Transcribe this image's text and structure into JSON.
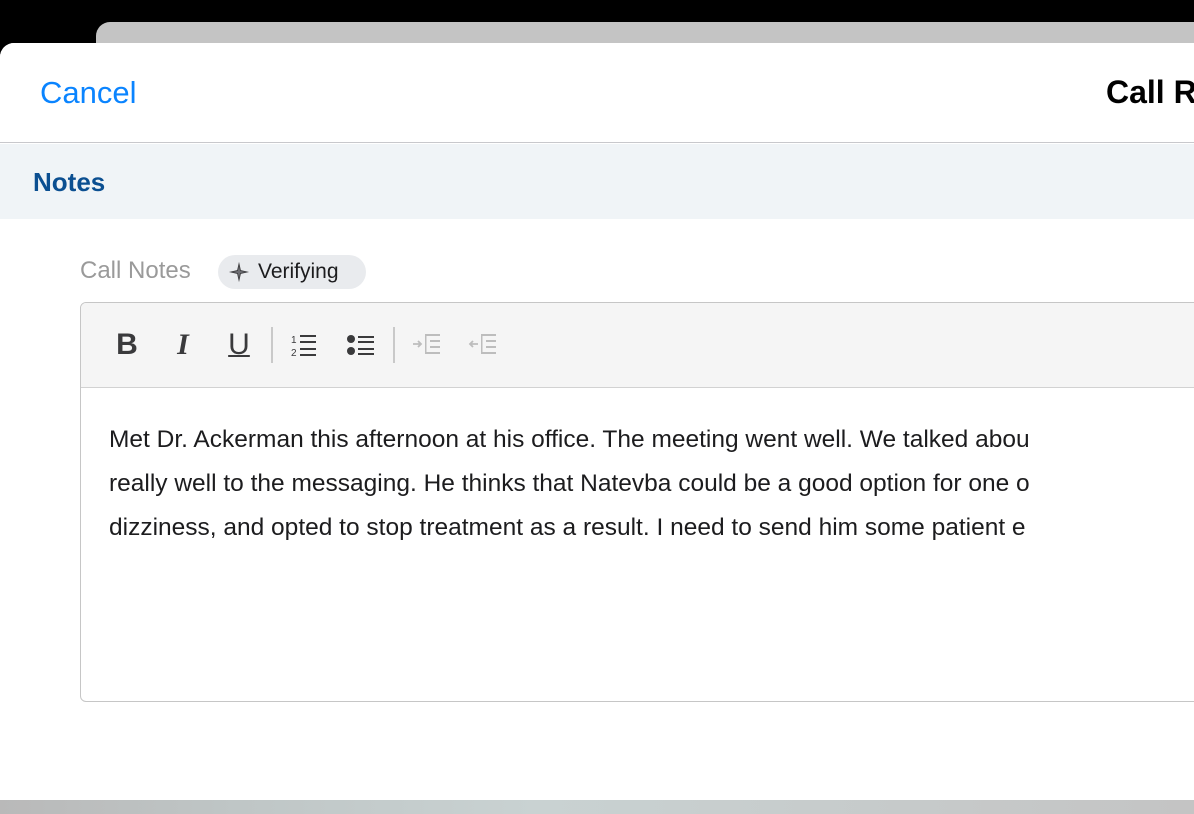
{
  "navbar": {
    "cancel_label": "Cancel",
    "title": "Call R"
  },
  "section": {
    "title": "Notes"
  },
  "field": {
    "label": "Call Notes",
    "badge_label": "Verifying",
    "badge_icon": "sparkle-icon"
  },
  "toolbar": {
    "buttons": [
      {
        "name": "bold",
        "glyph": "B",
        "icon": "bold-icon"
      },
      {
        "name": "italic",
        "glyph": "I",
        "icon": "italic-icon"
      },
      {
        "name": "underline",
        "glyph": "U",
        "icon": "underline-icon"
      },
      {
        "name": "ordered-list",
        "icon": "numbered-list-icon"
      },
      {
        "name": "bullet-list",
        "icon": "bulleted-list-icon"
      },
      {
        "name": "indent",
        "icon": "indent-icon",
        "disabled": true
      },
      {
        "name": "outdent",
        "icon": "outdent-icon",
        "disabled": true
      }
    ]
  },
  "editor": {
    "lines": [
      "Met Dr. Ackerman this afternoon at his office. The meeting went well. We talked abou",
      "really well to the messaging. He thinks that Natevba could be a good option for one o",
      "dizziness, and opted to stop treatment as a result. I need to send him some patient e"
    ]
  },
  "colors": {
    "accent": "#0a84ff",
    "section_title": "#0b4f91",
    "section_bg": "#f0f4f7",
    "badge_bg": "#e9ebee",
    "text": "#1c1c1e"
  }
}
